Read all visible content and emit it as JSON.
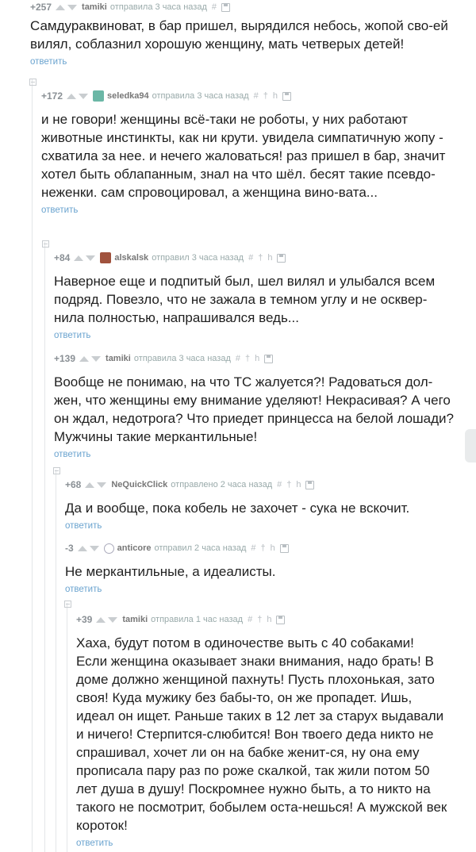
{
  "reply_label": "ответить",
  "comments": [
    {
      "rating": "+257",
      "user": "tamiki",
      "action": "отправила 3 часа назад",
      "text": "Самдураквиноват, в бар пришел, вырядился небось, жопой сво-ей вилял, соблазнил хорошую женщину, мать четверых детей!",
      "avatar": "none"
    },
    {
      "rating": "+172",
      "user": "seledka94",
      "action": "отправила 3 часа назад",
      "text": "и не говори! женщины всё-таки не роботы, у них работают животные инстинкты, как ни крути. увидела симпатичную жопу - схватила за нее. и нечего жаловаться! раз пришел в бар, значит хотел быть облапанным, знал на что шёл. бесят такие псевдо-неженки. сам спровоцировал, а женщина вино-вата...",
      "avatar": "#6bb7a6"
    },
    {
      "rating": "+84",
      "user": "alskalsk",
      "action": "отправил 3 часа назад",
      "text": "Наверное еще и подпитый был, шел вилял и улыбался всем подряд. Повезло, что не зажала в темном углу и не осквер-нила полностью, напрашивался ведь...",
      "avatar": "#a0523d"
    },
    {
      "rating": "+139",
      "user": "tamiki",
      "action": "отправила 3 часа назад",
      "text": "Вообще не понимаю, на что ТС жалуется?! Радоваться дол-жен, что женщины ему внимание уделяют! Некрасивая? А чего он ждал, недотрога? Что приедет принцесса на белой лошади? Мужчины такие меркантильные!",
      "avatar": "none"
    },
    {
      "rating": "+68",
      "user": "NeQuickClick",
      "action": "отправлено 2 часа назад",
      "text": "Да и вообще, пока кобель не захочет - сука не вскочит.",
      "avatar": "none"
    },
    {
      "rating": "-3",
      "user": "anticore",
      "action": "отправил 2 часа назад",
      "text": "Не меркантильные, а идеалисты.",
      "avatar": "circle"
    },
    {
      "rating": "+39",
      "user": "tamiki",
      "action": "отправила 1 час назад",
      "text": "Хаха, будут потом в одиночестве выть с 40 собаками! Если женщина оказывает знаки внимания, надо брать! В доме должно женщиной пахнуть! Пусть плохонькая, зато своя! Куда мужику без бабы-то, он же пропадет. Ишь, идеал он ищет. Раньше таких в 12 лет за старух выдавали и ничего! Стерпится-слюбится! Вон твоего деда никто не спрашивал, хочет ли он на бабке женит-ся, ну она ему прописала пару раз по роже скалкой, так жили потом 50 лет душа в душу! Поскромнее нужно быть, а то никто на такого не посмотрит, бобылем оста-нешься! А мужской век короток!",
      "avatar": "none"
    }
  ]
}
